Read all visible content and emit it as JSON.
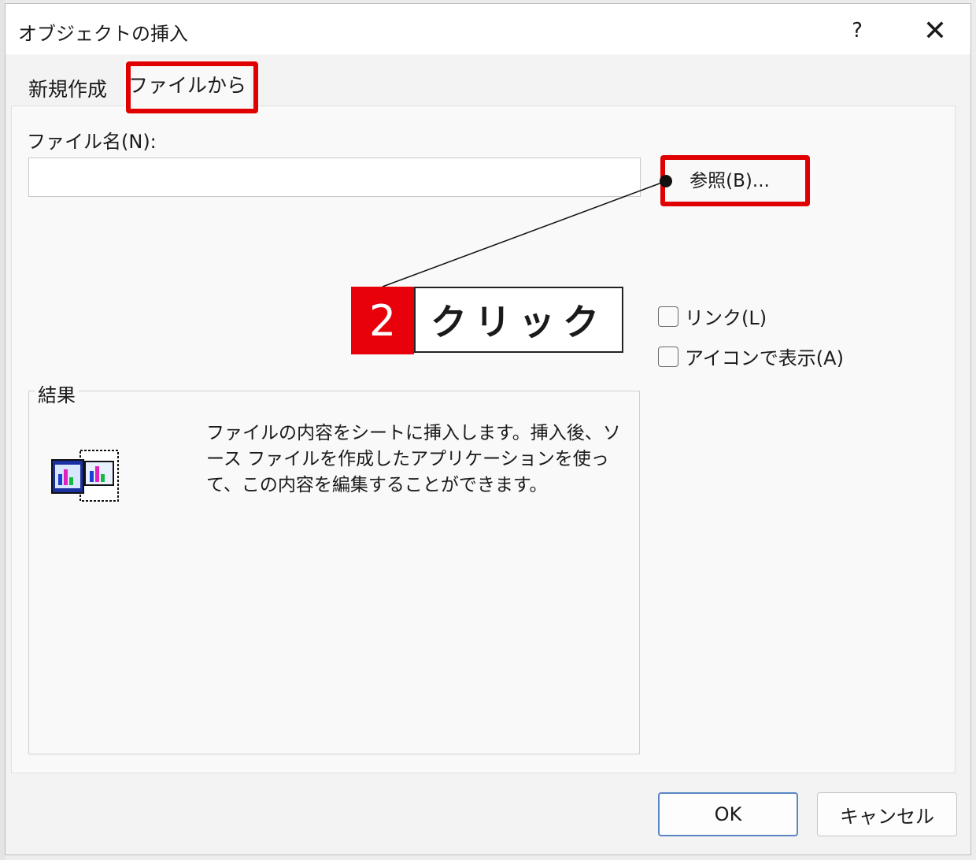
{
  "dialog": {
    "title": "オブジェクトの挿入",
    "help_label": "?",
    "close_label": "✕"
  },
  "tabs": [
    {
      "label": "新規作成",
      "selected": false
    },
    {
      "label": "ファイルから",
      "selected": true
    }
  ],
  "file": {
    "label": "ファイル名(N):",
    "value": "",
    "browse_label": "参照(B)..."
  },
  "options": {
    "link_label": "リンク(L)",
    "link_checked": false,
    "icon_label": "アイコンで表示(A)",
    "icon_checked": false
  },
  "result": {
    "label": "結果",
    "icon": "embedded-object-icon",
    "description": "ファイルの内容をシートに挿入します。挿入後、ソース ファイルを作成したアプリケーションを使って、この内容を編集することができます。"
  },
  "buttons": {
    "ok_label": "OK",
    "cancel_label": "キャンセル"
  },
  "annotation": {
    "step_number": "2",
    "step_text": "クリック",
    "highlight_color": "#e00000"
  }
}
